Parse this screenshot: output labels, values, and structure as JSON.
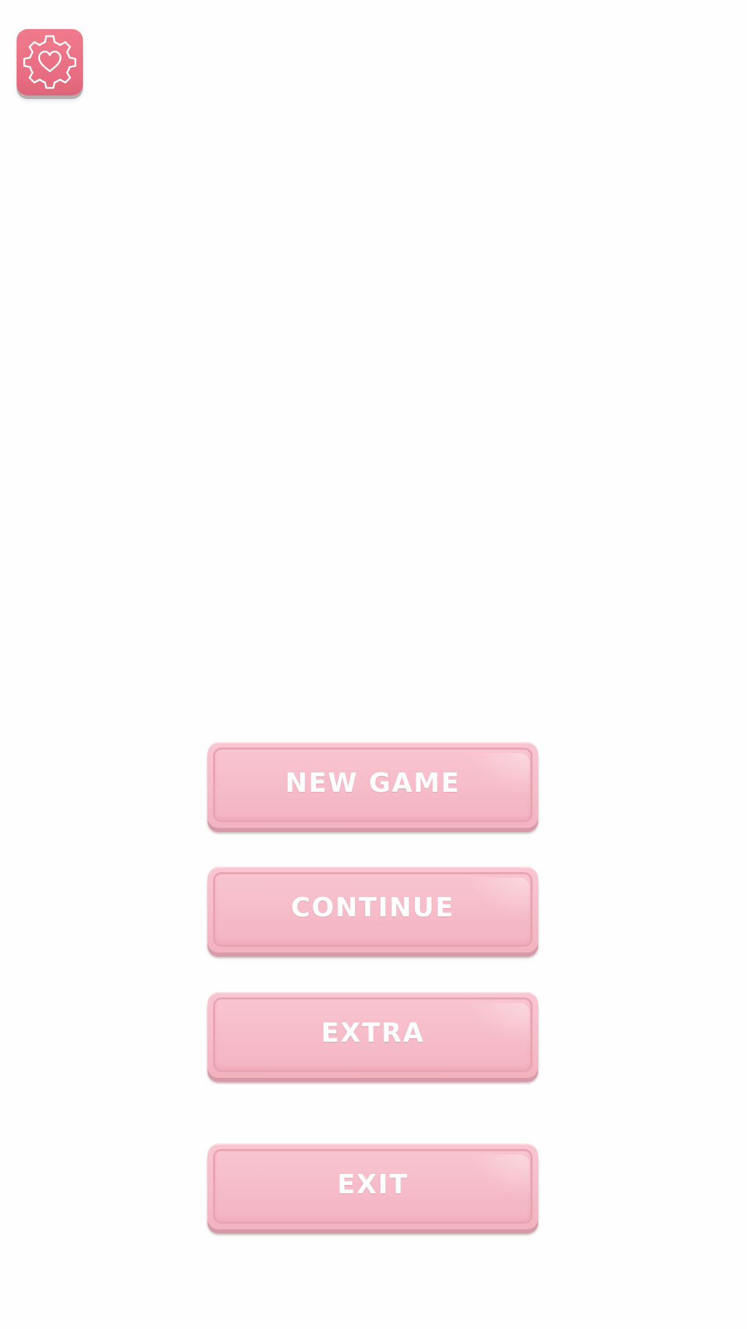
{
  "settings": {
    "icon": "gear-heart-icon",
    "color": "#ee7487"
  },
  "menu": {
    "new_game": "NEW GAME",
    "continue": "CONTINUE",
    "extra": "EXTRA",
    "exit": "EXIT"
  },
  "colors": {
    "button_fill": "#f7bfcc",
    "button_border": "#e9a4b4",
    "button_text": "#ffffff",
    "background": "#fefefe"
  }
}
